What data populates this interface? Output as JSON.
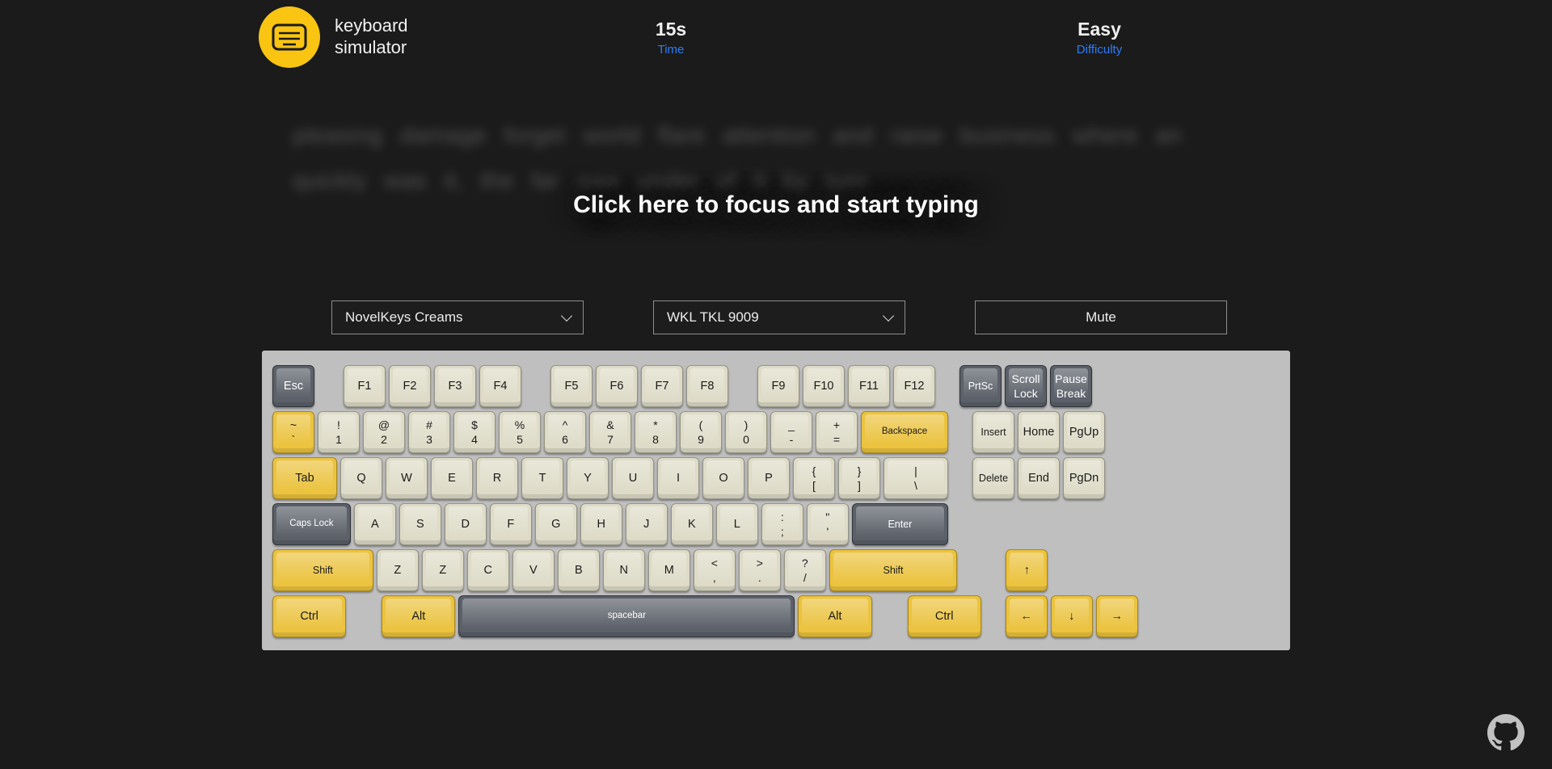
{
  "header": {
    "logo_icon": "keyboard-icon",
    "brand_name": "keyboard\nsimulator",
    "time_value": "15s",
    "time_label": "Time",
    "difficulty_value": "Easy",
    "difficulty_label": "Difficulty",
    "accent_yellow": "#f9c412",
    "accent_blue": "#2f7cf6"
  },
  "typing": {
    "words_line1": "pleasing damage forget world flare attention and raise business where an",
    "words_line2": "quickly was it, the far saw under of it by turn",
    "focus_prompt": "Click here to focus and start typing"
  },
  "controls": {
    "switch_select": "NovelKeys Creams",
    "keycap_select": "WKL TKL 9009",
    "mute_button": "Mute"
  },
  "keyboard": {
    "case_color": "#bfbfbf",
    "keycap_color": "#dedcc8",
    "accent_key_color": "#ebc33f",
    "modifier_key_color": "#5b6069",
    "rows": [
      {
        "name": "function-row",
        "keys": [
          {
            "name": "esc",
            "top": "",
            "bottom": "Esc",
            "style": "dark",
            "w": 1
          },
          {
            "name": "gap",
            "style": "gap-md"
          },
          {
            "name": "f1",
            "bottom": "F1",
            "style": "light",
            "w": 1
          },
          {
            "name": "f2",
            "bottom": "F2",
            "style": "light",
            "w": 1
          },
          {
            "name": "f3",
            "bottom": "F3",
            "style": "light",
            "w": 1
          },
          {
            "name": "f4",
            "bottom": "F4",
            "style": "light",
            "w": 1
          },
          {
            "name": "gap",
            "style": "gap-md"
          },
          {
            "name": "f5",
            "bottom": "F5",
            "style": "light",
            "w": 1
          },
          {
            "name": "f6",
            "bottom": "F6",
            "style": "light",
            "w": 1
          },
          {
            "name": "f7",
            "bottom": "F7",
            "style": "light",
            "w": 1
          },
          {
            "name": "f8",
            "bottom": "F8",
            "style": "light",
            "w": 1
          },
          {
            "name": "gap",
            "style": "gap-md"
          },
          {
            "name": "f9",
            "bottom": "F9",
            "style": "light",
            "w": 1
          },
          {
            "name": "f10",
            "bottom": "F10",
            "style": "light",
            "w": 1
          },
          {
            "name": "f11",
            "bottom": "F11",
            "style": "light",
            "w": 1
          },
          {
            "name": "f12",
            "bottom": "F12",
            "style": "light",
            "w": 1
          },
          {
            "name": "gap",
            "style": "gap-sm"
          },
          {
            "name": "prtsc",
            "bottom": "PrtSc",
            "style": "dark",
            "w": 1
          },
          {
            "name": "scroll-lock",
            "top": "Scroll",
            "bottom": "Lock",
            "style": "dark",
            "w": 1
          },
          {
            "name": "pause-break",
            "top": "Pause",
            "bottom": "Break",
            "style": "dark",
            "w": 1
          }
        ]
      },
      {
        "name": "number-row",
        "keys": [
          {
            "name": "backtick",
            "top": "~",
            "bottom": "`",
            "style": "yellow",
            "w": 1
          },
          {
            "name": "digit-1",
            "top": "!",
            "bottom": "1",
            "style": "light",
            "w": 1
          },
          {
            "name": "digit-2",
            "top": "@",
            "bottom": "2",
            "style": "light",
            "w": 1
          },
          {
            "name": "digit-3",
            "top": "#",
            "bottom": "3",
            "style": "light",
            "w": 1
          },
          {
            "name": "digit-4",
            "top": "$",
            "bottom": "4",
            "style": "light",
            "w": 1
          },
          {
            "name": "digit-5",
            "top": "%",
            "bottom": "5",
            "style": "light",
            "w": 1
          },
          {
            "name": "digit-6",
            "top": "^",
            "bottom": "6",
            "style": "light",
            "w": 1
          },
          {
            "name": "digit-7",
            "top": "&",
            "bottom": "7",
            "style": "light",
            "w": 1
          },
          {
            "name": "digit-8",
            "top": "*",
            "bottom": "8",
            "style": "light",
            "w": 1
          },
          {
            "name": "digit-9",
            "top": "(",
            "bottom": "9",
            "style": "light",
            "w": 1
          },
          {
            "name": "digit-0",
            "top": ")",
            "bottom": "0",
            "style": "light",
            "w": 1
          },
          {
            "name": "minus",
            "top": "_",
            "bottom": "-",
            "style": "light",
            "w": 1
          },
          {
            "name": "equals",
            "top": "+",
            "bottom": "=",
            "style": "light",
            "w": 1
          },
          {
            "name": "backspace",
            "bottom": "Backspace",
            "style": "yellow",
            "w": 2
          },
          {
            "name": "gap",
            "style": "gap-sm"
          },
          {
            "name": "insert",
            "bottom": "Insert",
            "style": "light",
            "w": 1
          },
          {
            "name": "home",
            "bottom": "Home",
            "style": "light",
            "w": 1
          },
          {
            "name": "pgup",
            "bottom": "PgUp",
            "style": "light",
            "w": 1
          }
        ]
      },
      {
        "name": "top-letter-row",
        "keys": [
          {
            "name": "tab",
            "bottom": "Tab",
            "style": "yellow",
            "w": 1.5
          },
          {
            "name": "key-q",
            "bottom": "Q",
            "style": "light",
            "w": 1
          },
          {
            "name": "key-w",
            "bottom": "W",
            "style": "light",
            "w": 1
          },
          {
            "name": "key-e",
            "bottom": "E",
            "style": "light",
            "w": 1
          },
          {
            "name": "key-r",
            "bottom": "R",
            "style": "light",
            "w": 1
          },
          {
            "name": "key-t",
            "bottom": "T",
            "style": "light",
            "w": 1
          },
          {
            "name": "key-y",
            "bottom": "Y",
            "style": "light",
            "w": 1
          },
          {
            "name": "key-u",
            "bottom": "U",
            "style": "light",
            "w": 1
          },
          {
            "name": "key-i",
            "bottom": "I",
            "style": "light",
            "w": 1
          },
          {
            "name": "key-o",
            "bottom": "O",
            "style": "light",
            "w": 1
          },
          {
            "name": "key-p",
            "bottom": "P",
            "style": "light",
            "w": 1
          },
          {
            "name": "bracket-left",
            "top": "{",
            "bottom": "[",
            "style": "light",
            "w": 1
          },
          {
            "name": "bracket-right",
            "top": "}",
            "bottom": "]",
            "style": "light",
            "w": 1
          },
          {
            "name": "backslash",
            "top": "|",
            "bottom": "\\",
            "style": "light",
            "w": 1.5
          },
          {
            "name": "gap",
            "style": "gap-sm"
          },
          {
            "name": "delete",
            "bottom": "Delete",
            "style": "light",
            "w": 1
          },
          {
            "name": "end",
            "bottom": "End",
            "style": "light",
            "w": 1
          },
          {
            "name": "pgdn",
            "bottom": "PgDn",
            "style": "light",
            "w": 1
          }
        ]
      },
      {
        "name": "home-row",
        "keys": [
          {
            "name": "caps-lock",
            "bottom": "Caps Lock",
            "style": "dark",
            "w": 1.8
          },
          {
            "name": "key-a",
            "bottom": "A",
            "style": "light",
            "w": 1
          },
          {
            "name": "key-s",
            "bottom": "S",
            "style": "light",
            "w": 1
          },
          {
            "name": "key-d",
            "bottom": "D",
            "style": "light",
            "w": 1
          },
          {
            "name": "key-f",
            "bottom": "F",
            "style": "light",
            "w": 1
          },
          {
            "name": "key-g",
            "bottom": "G",
            "style": "light",
            "w": 1
          },
          {
            "name": "key-h",
            "bottom": "H",
            "style": "light",
            "w": 1
          },
          {
            "name": "key-j",
            "bottom": "J",
            "style": "light",
            "w": 1
          },
          {
            "name": "key-k",
            "bottom": "K",
            "style": "light",
            "w": 1
          },
          {
            "name": "key-l",
            "bottom": "L",
            "style": "light",
            "w": 1
          },
          {
            "name": "semicolon",
            "top": ":",
            "bottom": ";",
            "style": "light",
            "w": 1
          },
          {
            "name": "quote",
            "top": "\"",
            "bottom": "'",
            "style": "light",
            "w": 1
          },
          {
            "name": "enter",
            "bottom": "Enter",
            "style": "dark",
            "w": 2.2
          }
        ]
      },
      {
        "name": "shift-row",
        "keys": [
          {
            "name": "shift-left",
            "bottom": "Shift",
            "style": "yellow",
            "w": 2.3
          },
          {
            "name": "key-z",
            "bottom": "Z",
            "style": "light",
            "w": 1
          },
          {
            "name": "key-x",
            "bottom": "Z",
            "style": "light",
            "w": 1
          },
          {
            "name": "key-c",
            "bottom": "C",
            "style": "light",
            "w": 1
          },
          {
            "name": "key-v",
            "bottom": "V",
            "style": "light",
            "w": 1
          },
          {
            "name": "key-b",
            "bottom": "B",
            "style": "light",
            "w": 1
          },
          {
            "name": "key-n",
            "bottom": "N",
            "style": "light",
            "w": 1
          },
          {
            "name": "key-m",
            "bottom": "M",
            "style": "light",
            "w": 1
          },
          {
            "name": "comma",
            "top": "<",
            "bottom": ",",
            "style": "light",
            "w": 1
          },
          {
            "name": "period",
            "top": ">",
            "bottom": ".",
            "style": "light",
            "w": 1
          },
          {
            "name": "slash",
            "top": "?",
            "bottom": "/",
            "style": "light",
            "w": 1
          },
          {
            "name": "shift-right",
            "bottom": "Shift",
            "style": "yellow",
            "w": 2.9
          },
          {
            "name": "gap",
            "style": "gap-xl"
          },
          {
            "name": "arrow-up",
            "bottom": "↑",
            "style": "yellow",
            "w": 1
          }
        ]
      },
      {
        "name": "bottom-row",
        "keys": [
          {
            "name": "ctrl-left",
            "bottom": "Ctrl",
            "style": "yellow",
            "w": 1.7
          },
          {
            "name": "gap",
            "style": "gap-lg"
          },
          {
            "name": "alt-left",
            "bottom": "Alt",
            "style": "yellow",
            "w": 1.7
          },
          {
            "name": "spacebar",
            "bottom": "spacebar",
            "style": "dark",
            "w": 7.5
          },
          {
            "name": "alt-right",
            "bottom": "Alt",
            "style": "yellow",
            "w": 1.7
          },
          {
            "name": "gap",
            "style": "gap-lg"
          },
          {
            "name": "ctrl-right",
            "bottom": "Ctrl",
            "style": "yellow",
            "w": 1.7
          },
          {
            "name": "gap",
            "style": "gap-sm"
          },
          {
            "name": "arrow-left",
            "bottom": "←",
            "style": "yellow",
            "w": 1
          },
          {
            "name": "arrow-down",
            "bottom": "↓",
            "style": "yellow",
            "w": 1
          },
          {
            "name": "arrow-right",
            "bottom": "→",
            "style": "yellow",
            "w": 1
          }
        ]
      }
    ]
  },
  "footer": {
    "github_icon": "github-icon"
  }
}
